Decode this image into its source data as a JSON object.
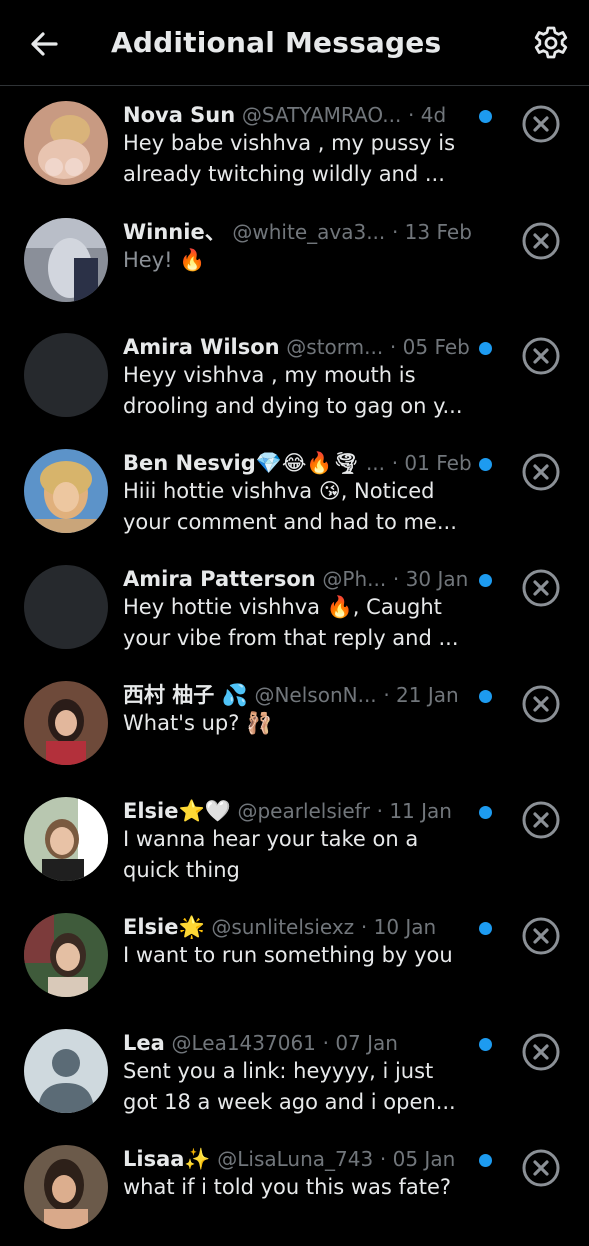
{
  "header": {
    "title": "Additional Messages",
    "back_icon": "arrow-left-icon",
    "settings_icon": "gear-icon"
  },
  "colors": {
    "background": "#000000",
    "accent": "#1d9bf0",
    "text_primary": "#e7e9ea",
    "text_secondary": "#71767b"
  },
  "messages": [
    {
      "name": "Nova Sun",
      "handle": "@SATYAMRAO...",
      "date": "· 4d",
      "unread": true,
      "line1": "Hey babe vishhva , my pussy is",
      "line2": "already twitching wildly and ..."
    },
    {
      "name": "Winnie、",
      "handle": "@white_ava3...",
      "date": "· 13 Feb",
      "unread": false,
      "line1": "Hey!  🔥",
      "line2": ""
    },
    {
      "name": "Amira Wilson",
      "handle": "@storm...",
      "date": "· 05 Feb",
      "unread": true,
      "line1": "Heyy vishhva  , my mouth is",
      "line2": "drooling and dying to gag on y..."
    },
    {
      "name": "Ben Nesvig💎😂🔥🌪",
      "handle": "...",
      "date": "· 01 Feb",
      "unread": true,
      "line1": "Hiii hottie vishhva 😘, Noticed",
      "line2": "your comment and had to me..."
    },
    {
      "name": "Amira Patterson",
      "handle": "@Ph...",
      "date": "· 30 Jan",
      "unread": true,
      "line1": "Hey hottie vishhva 🔥, Caught",
      "line2": "your vibe from that reply and ..."
    },
    {
      "name": "西村 柚子 💦",
      "handle": "@NelsonN...",
      "date": "· 21 Jan",
      "unread": true,
      "line1": "What's up?  🩰",
      "line2": ""
    },
    {
      "name": "Elsie⭐🤍",
      "handle": "@pearlelsiefr",
      "date": "· 11 Jan",
      "unread": true,
      "line1": "I wanna hear your take on a",
      "line2": "quick thing"
    },
    {
      "name": "Elsie🌟",
      "handle": "@sunlitelsiexz",
      "date": "· 10 Jan",
      "unread": true,
      "line1": "I want to run something by you",
      "line2": ""
    },
    {
      "name": "Lea",
      "handle": "@Lea1437061",
      "date": "· 07 Jan",
      "unread": true,
      "line1": "Sent you a link: heyyyy, i just",
      "line2": "got 18 a week ago and i open..."
    },
    {
      "name": "Lisaa✨",
      "handle": "@LisaLuna_743",
      "date": "· 05 Jan",
      "unread": true,
      "line1": "what if i told you this was fate?",
      "line2": ""
    }
  ]
}
